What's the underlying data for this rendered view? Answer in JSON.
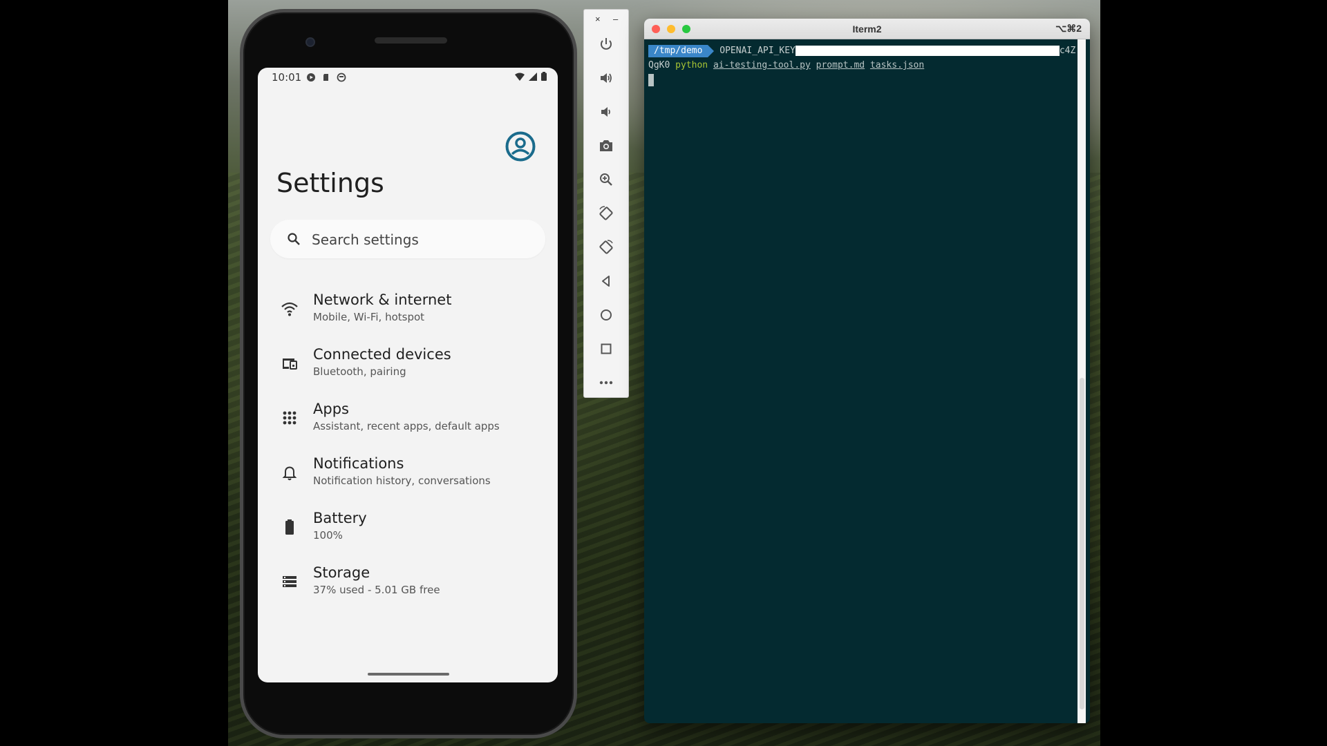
{
  "phone": {
    "status_time": "10:01",
    "settings_title": "Settings",
    "search_placeholder": "Search settings",
    "items": [
      {
        "label": "Network & internet",
        "sub": "Mobile, Wi-Fi, hotspot",
        "icon": "wifi-icon"
      },
      {
        "label": "Connected devices",
        "sub": "Bluetooth, pairing",
        "icon": "devices-icon"
      },
      {
        "label": "Apps",
        "sub": "Assistant, recent apps, default apps",
        "icon": "apps-grid-icon"
      },
      {
        "label": "Notifications",
        "sub": "Notification history, conversations",
        "icon": "bell-icon"
      },
      {
        "label": "Battery",
        "sub": "100%",
        "icon": "battery-icon"
      },
      {
        "label": "Storage",
        "sub": "37% used - 5.01 GB free",
        "icon": "storage-icon"
      }
    ],
    "accent_color": "#1a6b8c"
  },
  "emulator_toolbar": {
    "close": "×",
    "minimize": "–",
    "buttons": [
      "power-icon",
      "volume-up-icon",
      "volume-down-icon",
      "camera-icon",
      "zoom-icon",
      "rotate-left-icon",
      "rotate-right-icon",
      "back-icon",
      "home-icon",
      "overview-icon",
      "more-icon"
    ]
  },
  "iterm": {
    "window_title": "Iterm2",
    "shortcut": "⌥⌘2",
    "prompt_dir": "/tmp/demo",
    "env_prefix": "OPENAI_API_KEY",
    "env_suffix": "c4Z",
    "line2_prefix": "QgK0",
    "cmd": "python",
    "args": [
      "ai-testing-tool.py",
      "prompt.md",
      "tasks.json"
    ]
  }
}
